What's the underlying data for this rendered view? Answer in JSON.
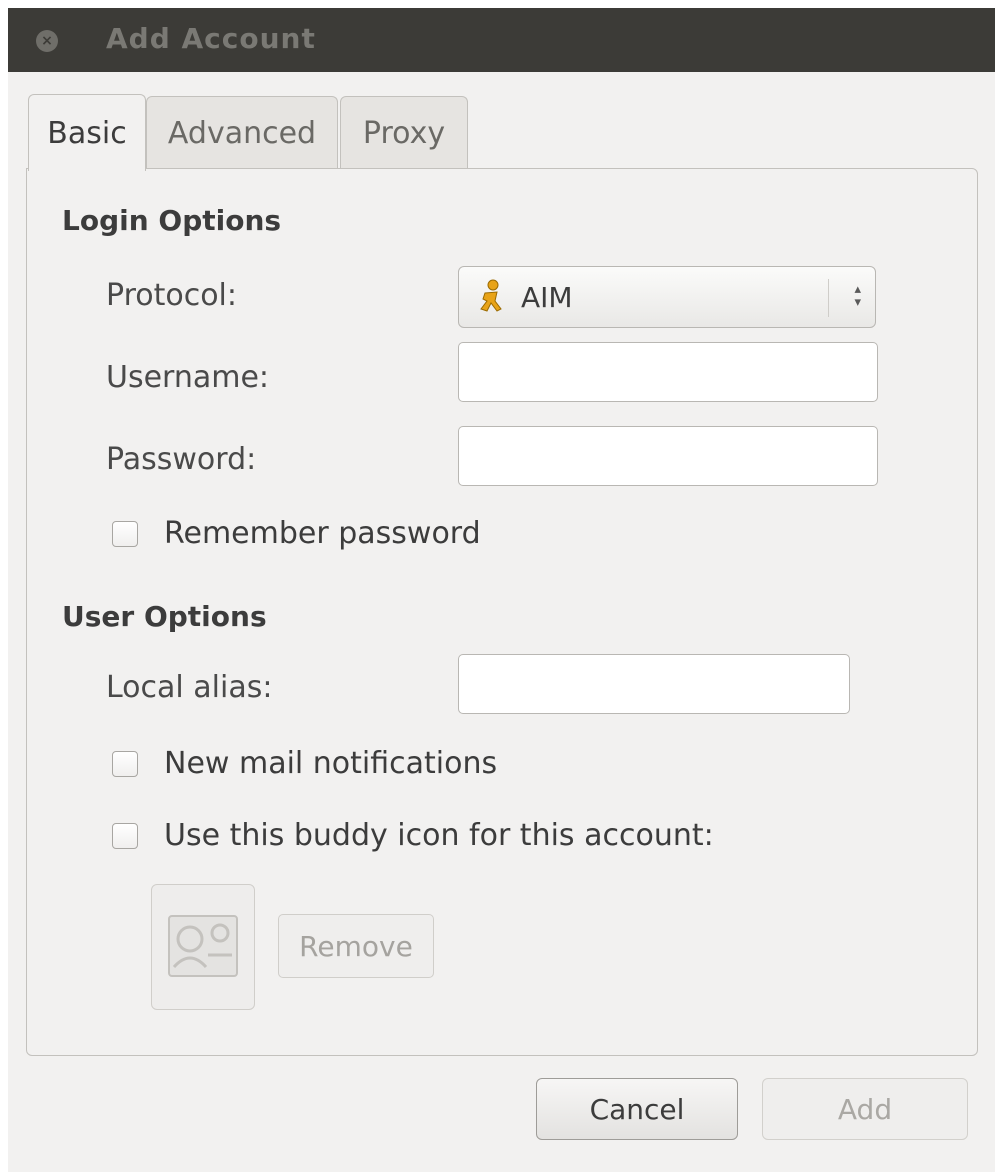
{
  "window": {
    "title": "Add Account"
  },
  "tabs": [
    {
      "label": "Basic",
      "active": true
    },
    {
      "label": "Advanced",
      "active": false
    },
    {
      "label": "Proxy",
      "active": false
    }
  ],
  "login_options": {
    "heading": "Login Options",
    "protocol_label": "Protocol:",
    "protocol_value": "AIM",
    "protocol_icon": "aim-running-man-icon",
    "username_label": "Username:",
    "username_value": "",
    "password_label": "Password:",
    "password_value": "",
    "remember_password_label": "Remember password",
    "remember_password_checked": false
  },
  "user_options": {
    "heading": "User Options",
    "local_alias_label": "Local alias:",
    "local_alias_value": "",
    "new_mail_label": "New mail notifications",
    "new_mail_checked": false,
    "buddy_icon_label": "Use this buddy icon for this account:",
    "buddy_icon_checked": false,
    "remove_label": "Remove"
  },
  "buttons": {
    "cancel_label": "Cancel",
    "add_label": "Add"
  },
  "colors": {
    "titlebar": "#3c3b37",
    "window_bg": "#f2f1f0",
    "aim_icon": "#e8a317"
  }
}
